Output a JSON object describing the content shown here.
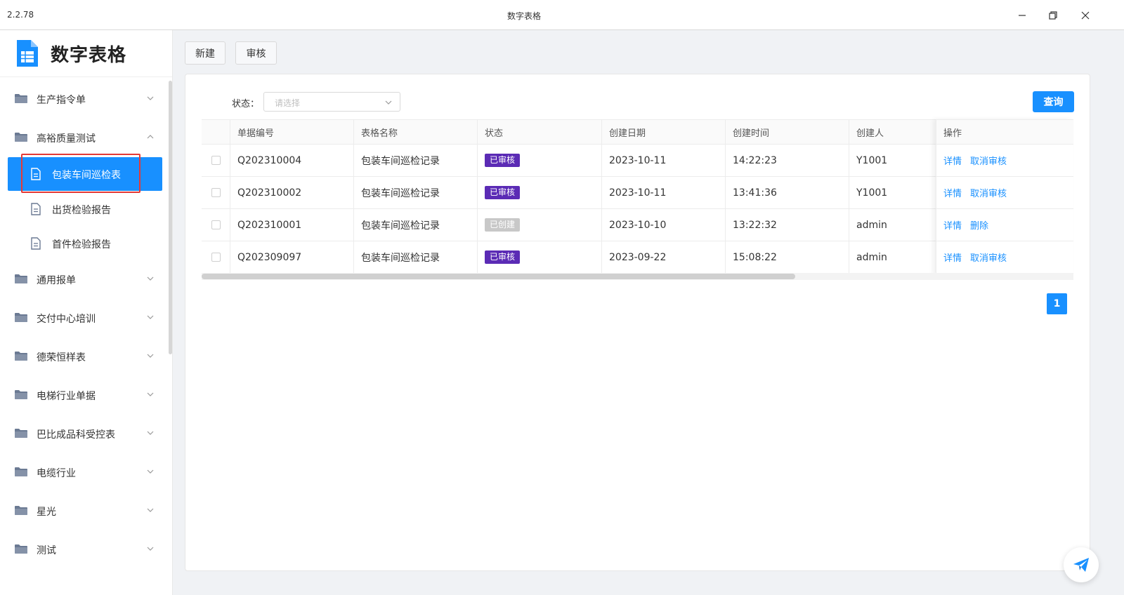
{
  "window": {
    "version": "2.2.78",
    "title": "数字表格"
  },
  "sidebar": {
    "brand": "数字表格",
    "menus": [
      {
        "label": "生产指令单",
        "expanded": false
      },
      {
        "label": "高裕质量测试",
        "expanded": true
      },
      {
        "label": "通用报单",
        "expanded": false
      },
      {
        "label": "交付中心培训",
        "expanded": false
      },
      {
        "label": "德荣恒样表",
        "expanded": false
      },
      {
        "label": "电梯行业单据",
        "expanded": false
      },
      {
        "label": "巴比成品科受控表",
        "expanded": false
      },
      {
        "label": "电缆行业",
        "expanded": false
      },
      {
        "label": "星光",
        "expanded": false
      },
      {
        "label": "测试",
        "expanded": false
      }
    ],
    "submenu": [
      {
        "label": "包装车间巡检表",
        "active": true
      },
      {
        "label": "出货检验报告",
        "active": false
      },
      {
        "label": "首件检验报告",
        "active": false
      }
    ]
  },
  "toolbar": {
    "new_label": "新建",
    "audit_label": "审核"
  },
  "filter": {
    "status_label": "状态：",
    "status_placeholder": "请选择",
    "query_label": "查询"
  },
  "table": {
    "columns": [
      "单据编号",
      "表格名称",
      "状态",
      "创建日期",
      "创建时间",
      "创建人",
      "操作"
    ],
    "rows": [
      {
        "id": "Q202310004",
        "name": "包装车间巡检记录",
        "status": "已审核",
        "date": "2023-10-11",
        "time": "14:22:23",
        "creator": "Y1001",
        "actions": [
          "详情",
          "取消审核"
        ]
      },
      {
        "id": "Q202310002",
        "name": "包装车间巡检记录",
        "status": "已审核",
        "date": "2023-10-11",
        "time": "13:41:36",
        "creator": "Y1001",
        "actions": [
          "详情",
          "取消审核"
        ]
      },
      {
        "id": "Q202310001",
        "name": "包装车间巡检记录",
        "status": "已创建",
        "date": "2023-10-10",
        "time": "13:22:32",
        "creator": "admin",
        "actions": [
          "详情",
          "删除"
        ]
      },
      {
        "id": "Q202309097",
        "name": "包装车间巡检记录",
        "status": "已审核",
        "date": "2023-09-22",
        "time": "15:08:22",
        "creator": "admin",
        "actions": [
          "详情",
          "取消审核"
        ]
      }
    ]
  },
  "pagination": {
    "current": "1"
  },
  "colors": {
    "accent": "#1890ff",
    "status_audited": "#5b2bb5",
    "status_created": "#c8c8c8",
    "highlight": "#e53935",
    "folder": "#6b7a93"
  }
}
